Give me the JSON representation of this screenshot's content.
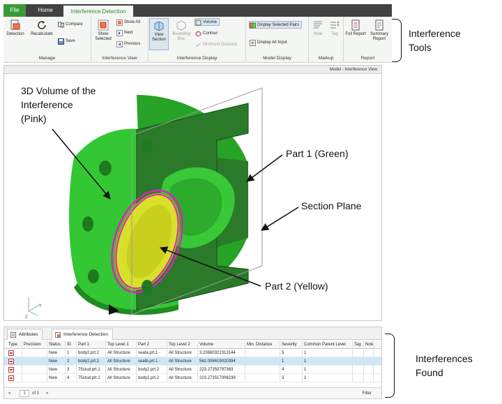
{
  "ribbon": {
    "tabs": [
      {
        "label": "File"
      },
      {
        "label": "Home"
      },
      {
        "label": "Interference Detection"
      }
    ],
    "groups": {
      "manage": {
        "label": "Manage",
        "detection": "Detection",
        "recalculate": "Recalculate",
        "compare": "Compare",
        "save": "Save"
      },
      "interference_view": {
        "label": "Interference View",
        "show_selected": "Show Selected",
        "show_all": "Show All",
        "next": "Next",
        "previous": "Previous"
      },
      "interference_display": {
        "label": "Interference Display",
        "view_section": "View Section",
        "bounding_box": "Bounding Box",
        "volume": "Volume",
        "contour": "Contour",
        "minimum_distance": "Minimum Distance"
      },
      "model_display": {
        "label": "Model Display",
        "display_selected_pairs": "Display Selected Pairs",
        "display_all_input": "Display All Input"
      },
      "markup": {
        "label": "Markup",
        "note": "Note",
        "tag": "Tag"
      },
      "report": {
        "label": "Report",
        "full_report": "Full Report",
        "summary_report": "Summary Report"
      }
    }
  },
  "viewport": {
    "title": "Model - Interference View",
    "triad": {
      "y": "Y",
      "z": "Z"
    }
  },
  "panel": {
    "tabs": [
      {
        "label": "Attributes"
      },
      {
        "label": "Interference Detection"
      }
    ],
    "columns": [
      "Type",
      "Precision",
      "Status",
      "ID",
      "Part 1",
      "Top Level 1",
      "Part 2",
      "Top Level 2",
      "Volume",
      "Min. Distance",
      "Severity",
      "Common Parent Level",
      "Tag",
      "Note"
    ],
    "rows": [
      {
        "precision": "",
        "status": "New",
        "id": "1",
        "part1": "body2.prt.2",
        "top1": "All Structure",
        "part2": "seata.prt.1 -",
        "top2": "All Structure",
        "volume": "3.20880322313144",
        "min_distance": "",
        "severity": "5",
        "common_parent": "1",
        "tag": "",
        "note": ""
      },
      {
        "precision": "",
        "status": "New",
        "id": "2",
        "part1": "body2.prt.2",
        "top1": "All Structure",
        "part2": "seatb.prt.1 -",
        "top2": "All Structure",
        "volume": "562.006619020394",
        "min_distance": "",
        "severity": "1",
        "common_parent": "1",
        "tag": "",
        "note": ""
      },
      {
        "precision": "",
        "status": "New",
        "id": "3",
        "part1": "75stud.prt.1",
        "top1": "All Structure",
        "part2": "body2.prt.2",
        "top2": "All Structure",
        "volume": "223.27350797383",
        "min_distance": "",
        "severity": "4",
        "common_parent": "1",
        "tag": "",
        "note": ""
      },
      {
        "precision": "",
        "status": "New",
        "id": "4",
        "part1": "75stud.prt.1",
        "top1": "All Structure",
        "part2": "body2.prt.2",
        "top2": "All Structure",
        "volume": "223.273517008238",
        "min_distance": "",
        "severity": "3",
        "common_parent": "1",
        "tag": "",
        "note": ""
      }
    ],
    "selected_row": 1,
    "pager": {
      "page": "1",
      "of": "of 1",
      "filter": "Filter"
    }
  },
  "annotations": {
    "tools": {
      "line1": "Interference",
      "line2": "Tools"
    },
    "volume": {
      "line1": "3D Volume of the",
      "line2": "Interference",
      "line3": "(Pink)"
    },
    "part1": "Part 1 (Green)",
    "section_plane": "Section Plane",
    "part2": "Part 2 (Yellow)",
    "found": {
      "line1": "Interferences",
      "line2": "Found"
    }
  },
  "colors": {
    "accent_green": "#3a9a3a",
    "part1_green": "#2ecc2e",
    "part2_yellow": "#e6e600",
    "interference_pink": "#e020c0",
    "selected_row": "#cfe8f7"
  },
  "icons": [
    "detection-icon",
    "recalculate-icon",
    "compare-icon",
    "save-icon",
    "show-selected-icon",
    "show-all-icon",
    "next-icon",
    "previous-icon",
    "view-section-icon",
    "bounding-box-icon",
    "volume-icon",
    "contour-icon",
    "minimum-distance-icon",
    "display-selected-pairs-icon",
    "display-all-input-icon",
    "note-icon",
    "tag-icon",
    "full-report-icon",
    "summary-report-icon",
    "interference-type-icon"
  ]
}
